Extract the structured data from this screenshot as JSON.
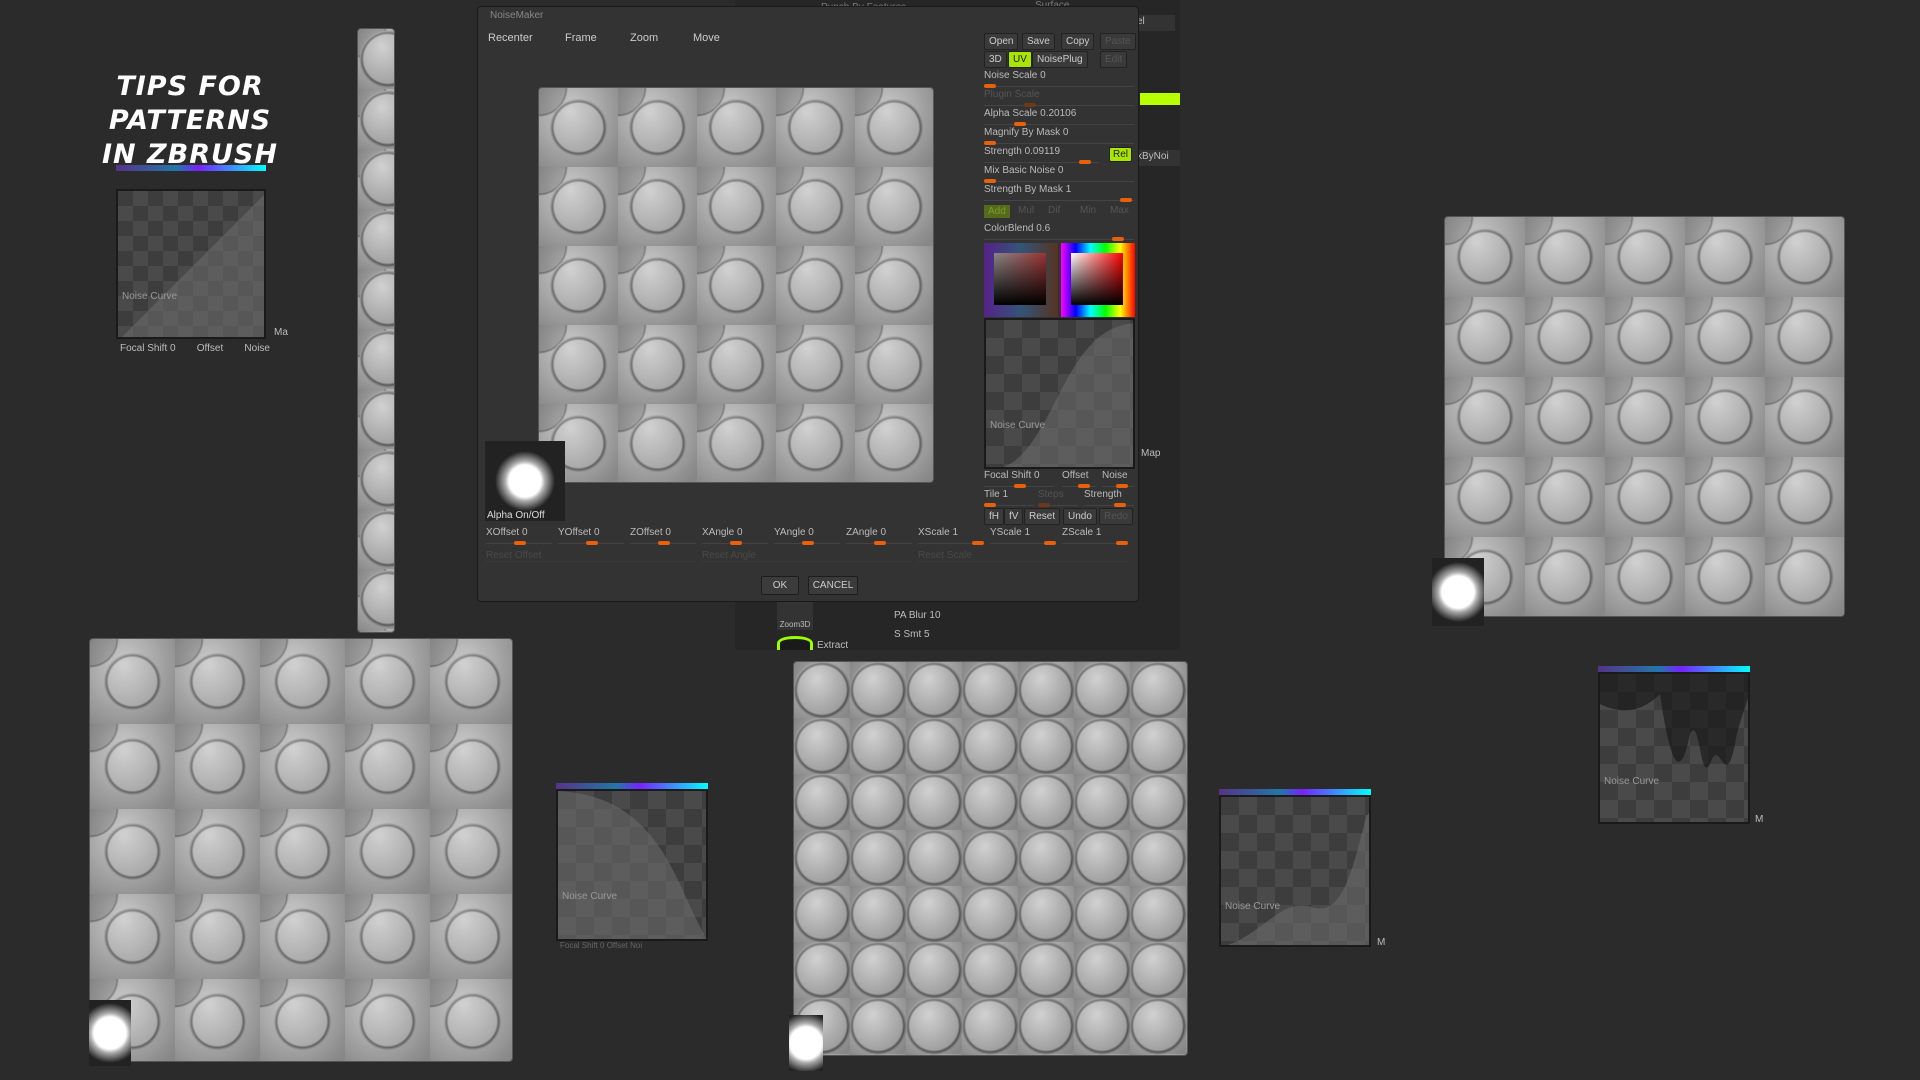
{
  "title_line1": "TIPS FOR PATTERNS",
  "title_line2": "IN ZBRUSH",
  "dialog": {
    "title": "NoiseMaker",
    "view_buttons": [
      "Recenter",
      "Frame",
      "Zoom",
      "Move"
    ],
    "file_buttons": [
      "Open",
      "Save",
      "Copy",
      "Paste"
    ],
    "mode_buttons": [
      "3D",
      "UV",
      "NoisePlug",
      "Edit"
    ],
    "sliders": [
      {
        "label": "Noise Scale",
        "value": "0"
      },
      {
        "label": "Plugin Scale",
        "value": ""
      },
      {
        "label": "Alpha Scale",
        "value": "0.20106"
      },
      {
        "label": "Magnify By Mask",
        "value": "0"
      },
      {
        "label": "Strength",
        "value": "0.09119"
      },
      {
        "label": "Mix Basic Noise",
        "value": "0"
      },
      {
        "label": "Strength By Mask",
        "value": "1"
      }
    ],
    "rel_label": "Rel",
    "blend_modes": [
      "Add",
      "Mul",
      "Dif",
      "Min",
      "Max"
    ],
    "color_blend_label": "ColorBlend 0.6",
    "noise_curve_label": "Noise Curve",
    "focal_shift_label": "Focal Shift 0",
    "offset_label": "Offset",
    "noise_label": "Noise",
    "tile_label": "Tile 1",
    "steps_label": "Steps",
    "strength_label": "Strength",
    "curve_buttons": [
      "fH",
      "fV",
      "Reset",
      "Undo",
      "Redo"
    ],
    "alpha_label": "Alpha On/Off",
    "axis_sliders": [
      "XOffset 0",
      "YOffset 0",
      "ZOffset 0",
      "XAngle 0",
      "YAngle 0",
      "ZAngle 0",
      "XScale 1",
      "YScale 1",
      "ZScale 1"
    ],
    "reset_buttons": [
      "Reset Offset",
      "Reset Angle",
      "Reset Scale"
    ],
    "ok_label": "OK",
    "cancel_label": "CANCEL"
  },
  "background_panel": {
    "top_label_1": "Punch By Features",
    "top_label_2": "Surface",
    "right_label_1": "el",
    "right_label_2": "kByNoi",
    "map_label": "Map",
    "pa_blur": "PA Blur 10",
    "s_smt": "S Smt 5",
    "zoom3d": "Zoom3D",
    "extract": "Extract"
  },
  "small_curve_panel": {
    "label": "Noise Curve",
    "focal": "Focal Shift 0",
    "offset": "Offset",
    "noise": "Noise",
    "side_label": "Ma"
  },
  "curve_panels": [
    {
      "label": "Noise Curve",
      "footer": "Focal Shift 0 Offset Noi"
    },
    {
      "label": "Noise Curve",
      "side": "M"
    },
    {
      "label": "Noise Curve",
      "side": "M"
    }
  ]
}
